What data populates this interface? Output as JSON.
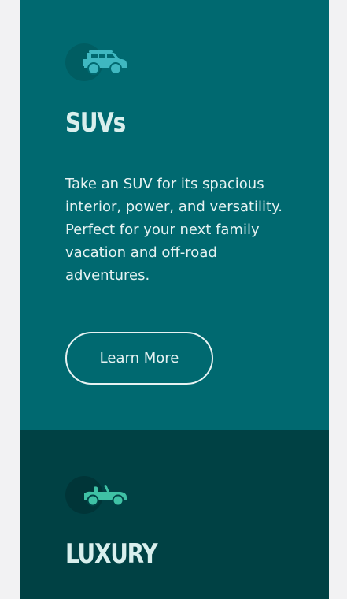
{
  "cards": [
    {
      "icon": "suv-icon",
      "title": "SUVs",
      "description": "Take an SUV for its spacious interior, power, and versatility. Perfect for your next family vacation and off-road adventures.",
      "button_label": "Learn More",
      "background": "#006970",
      "icon_color": "#3fb8c1"
    },
    {
      "icon": "convertible-car-icon",
      "title": "LUXURY",
      "background": "#004144",
      "icon_color": "#3fc1a5"
    }
  ]
}
